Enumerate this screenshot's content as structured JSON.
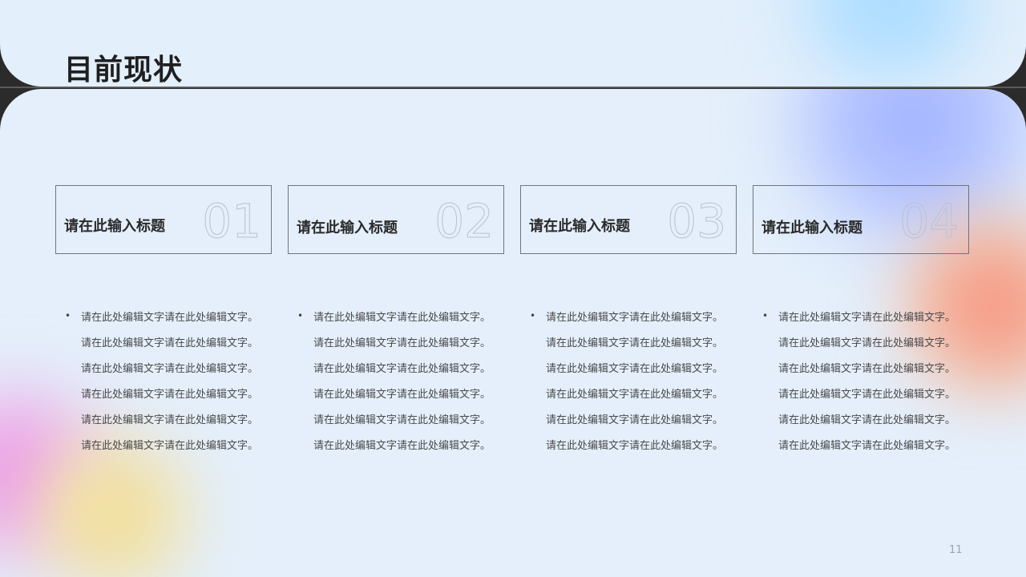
{
  "title": "目前现状",
  "cards": [
    {
      "title": "请在此输入标题",
      "num": "01"
    },
    {
      "title": "请在此输入标题",
      "num": "02"
    },
    {
      "title": "请在此输入标题",
      "num": "03"
    },
    {
      "title": "请在此输入标题",
      "num": "04"
    }
  ],
  "columns": [
    {
      "bullet": "•",
      "lines": [
        "请在此处编辑文字请在此处编辑文字。",
        "请在此处编辑文字请在此处编辑文字。",
        "请在此处编辑文字请在此处编辑文字。",
        "请在此处编辑文字请在此处编辑文字。",
        "请在此处编辑文字请在此处编辑文字。",
        "请在此处编辑文字请在此处编辑文字。"
      ]
    },
    {
      "bullet": "•",
      "lines": [
        "请在此处编辑文字请在此处编辑文字。",
        "请在此处编辑文字请在此处编辑文字。",
        "请在此处编辑文字请在此处编辑文字。",
        "请在此处编辑文字请在此处编辑文字。",
        "请在此处编辑文字请在此处编辑文字。",
        "请在此处编辑文字请在此处编辑文字。"
      ]
    },
    {
      "bullet": "•",
      "lines": [
        "请在此处编辑文字请在此处编辑文字。",
        "请在此处编辑文字请在此处编辑文字。",
        "请在此处编辑文字请在此处编辑文字。",
        "请在此处编辑文字请在此处编辑文字。",
        "请在此处编辑文字请在此处编辑文字。",
        "请在此处编辑文字请在此处编辑文字。"
      ]
    },
    {
      "bullet": "•",
      "lines": [
        "请在此处编辑文字请在此处编辑文字。",
        "请在此处编辑文字请在此处编辑文字。",
        "请在此处编辑文字请在此处编辑文字。",
        "请在此处编辑文字请在此处编辑文字。",
        "请在此处编辑文字请在此处编辑文字。",
        "请在此处编辑文字请在此处编辑文字。"
      ]
    }
  ],
  "page_number": "11",
  "colors": {
    "background": "#e4effb",
    "title": "#1f1f1f",
    "card_border": "#6e7582",
    "card_number_outline": "#b9c2d0",
    "body_text": "#4a4a4a"
  }
}
